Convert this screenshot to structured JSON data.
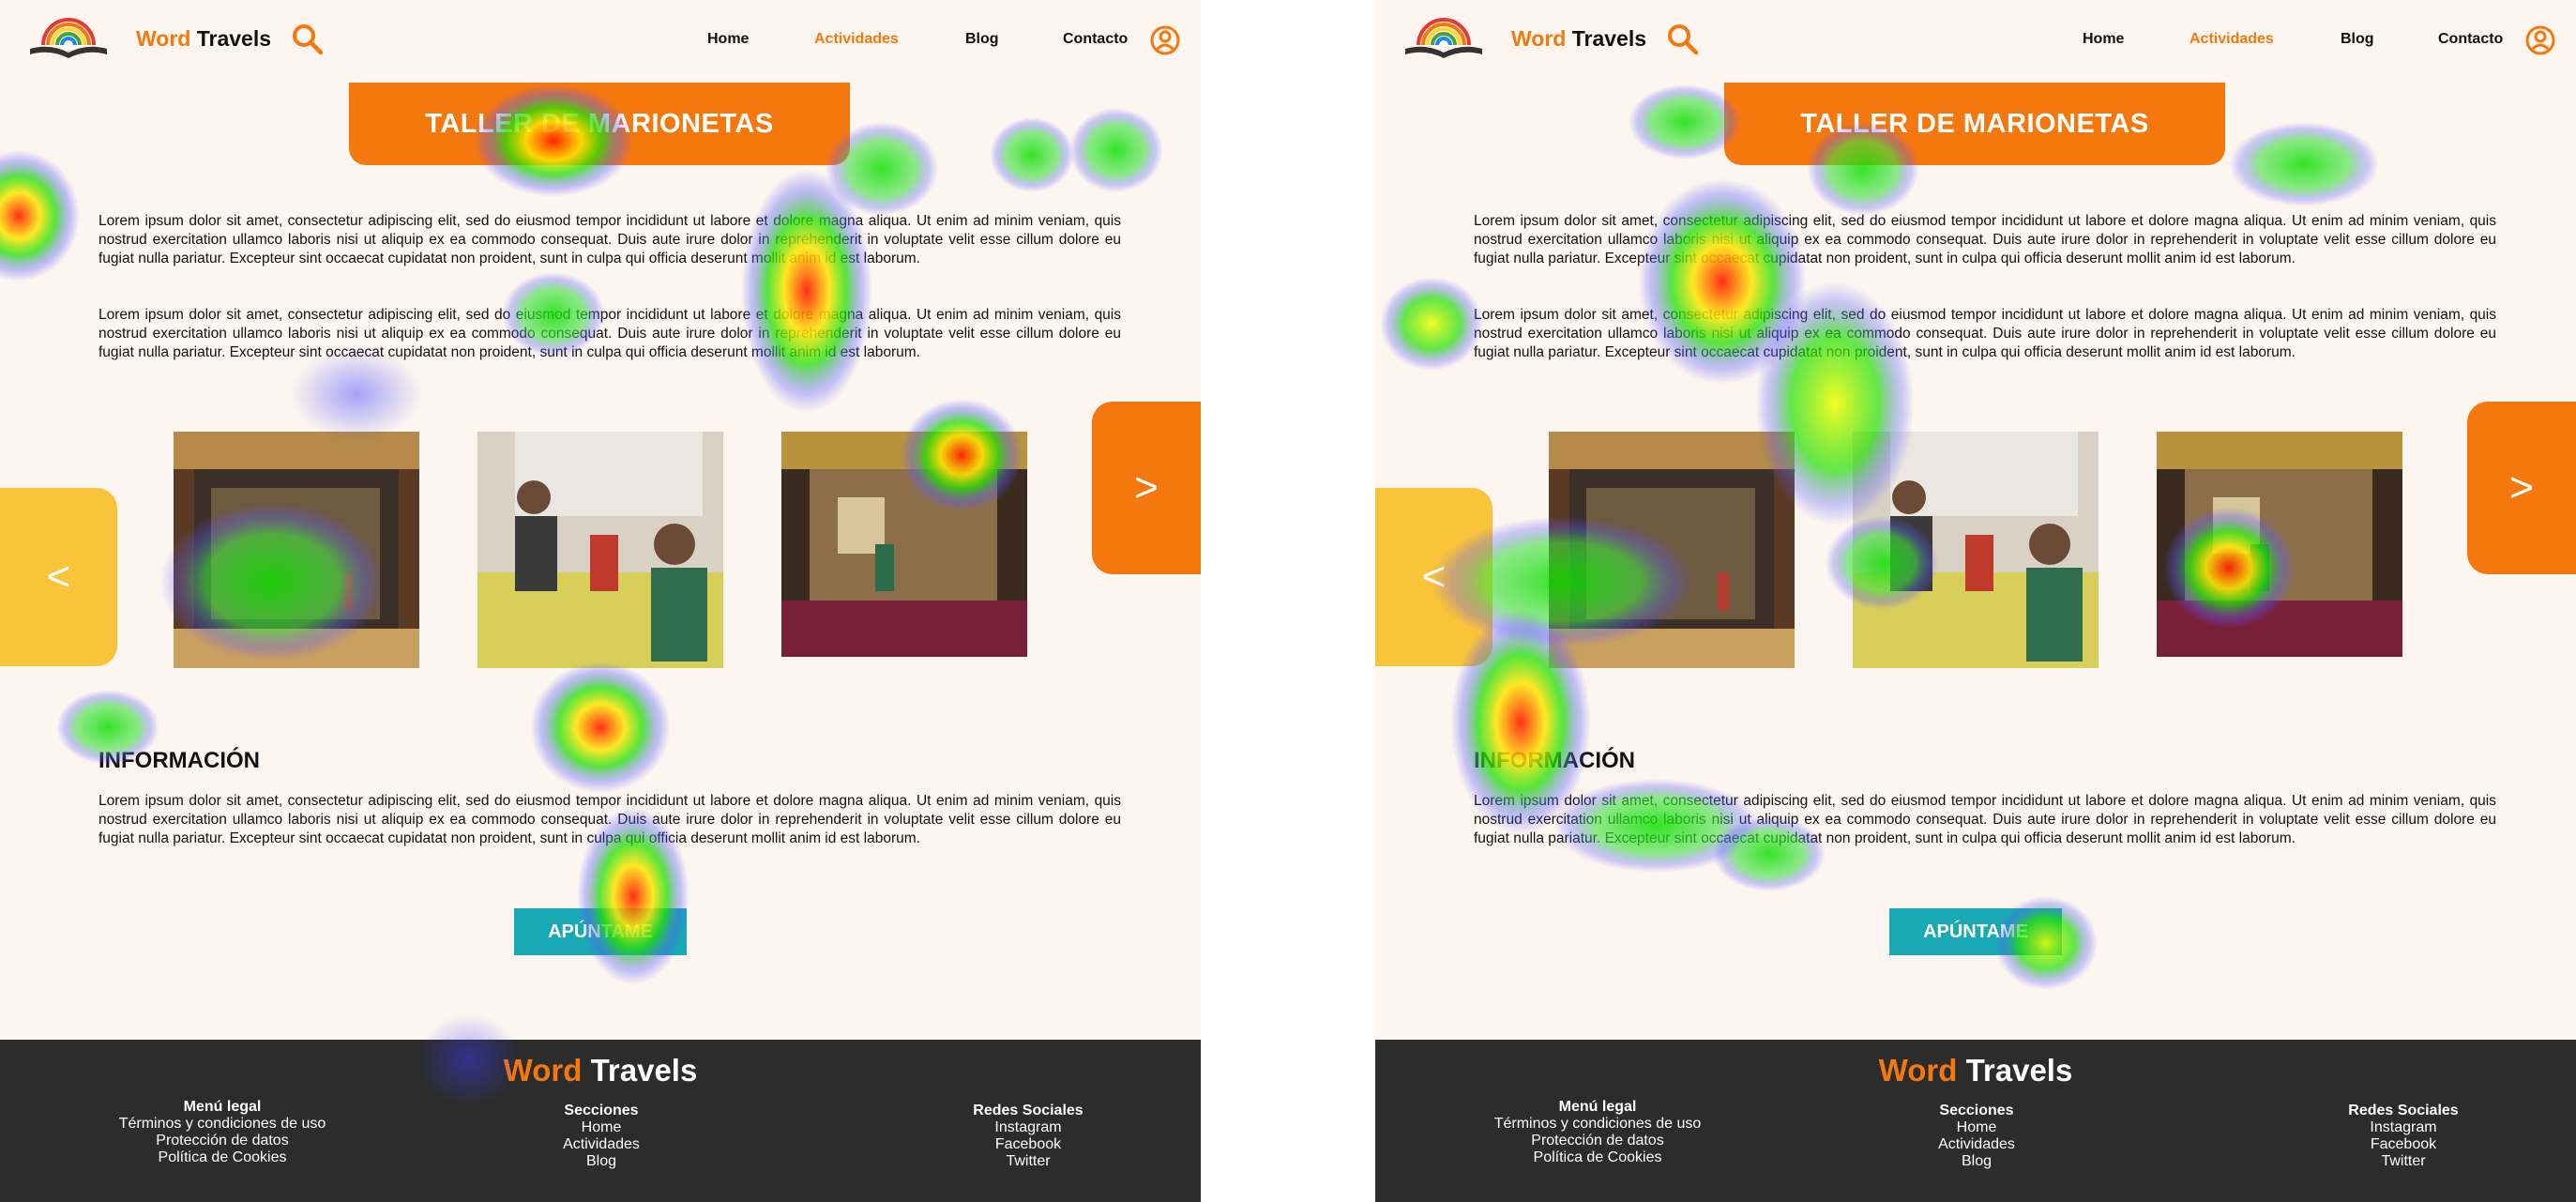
{
  "panels": [
    {
      "header": {
        "brand_word": "Word",
        "brand_rest": "Travels",
        "nav": [
          "Home",
          "Actividades",
          "Blog",
          "Contacto"
        ],
        "active_nav": "Actividades"
      },
      "banner": {
        "title": "TALLER DE MARIONETAS"
      },
      "paragraphs": [
        "Lorem ipsum dolor sit amet, consectetur adipiscing elit, sed do eiusmod tempor incididunt ut labore et dolore magna aliqua. Ut enim ad minim veniam, quis nostrud exercitation ullamco laboris nisi ut aliquip ex ea commodo consequat. Duis aute irure dolor in reprehenderit in voluptate velit esse cillum dolore eu fugiat nulla pariatur. Excepteur sint occaecat cupidatat non proident, sunt in culpa qui officia deserunt mollit anim id est laborum.",
        "Lorem ipsum dolor sit amet, consectetur adipiscing elit, sed do eiusmod tempor incididunt ut labore et dolore magna aliqua. Ut enim ad minim veniam, quis nostrud exercitation ullamco laboris nisi ut aliquip ex ea commodo consequat. Duis aute irure dolor in reprehenderit in voluptate velit esse cillum dolore eu fugiat nulla pariatur. Excepteur sint occaecat cupidatat non proident, sunt in culpa qui officia deserunt mollit anim id est laborum."
      ],
      "carousel": {
        "prev": "<",
        "next": ">"
      },
      "info": {
        "title": "INFORMACIÓN",
        "text": "Lorem ipsum dolor sit amet, consectetur adipiscing elit, sed do eiusmod tempor incididunt ut labore et dolore magna aliqua. Ut enim ad minim veniam, quis nostrud exercitation ullamco laboris nisi ut aliquip ex ea commodo consequat. Duis aute irure dolor in reprehenderit in voluptate velit esse cillum dolore eu fugiat nulla pariatur. Excepteur sint occaecat cupidatat non proident, sunt in culpa qui officia deserunt mollit anim id est laborum."
      },
      "cta": "APÚNTAME",
      "footer": {
        "brand_word": "Word",
        "brand_rest": "Travels",
        "legal": {
          "title": "Menú legal",
          "items": [
            "Términos y condiciones de uso",
            "Protección de datos",
            "Política de Cookies"
          ]
        },
        "sections": {
          "title": "Secciones",
          "items": [
            "Home",
            "Actividades",
            "Blog"
          ]
        },
        "social": {
          "title": "Redes Sociales",
          "items": [
            "Instagram",
            "Facebook",
            "Twitter"
          ]
        }
      }
    },
    {
      "header": {
        "brand_word": "Word",
        "brand_rest": "Travels",
        "nav": [
          "Home",
          "Actividades",
          "Blog",
          "Contacto"
        ],
        "active_nav": "Actividades"
      },
      "banner": {
        "title": "TALLER DE MARIONETAS"
      },
      "paragraphs": [
        "Lorem ipsum dolor sit amet, consectetur adipiscing elit, sed do eiusmod tempor incididunt ut labore et dolore magna aliqua. Ut enim ad minim veniam, quis nostrud exercitation ullamco laboris nisi ut aliquip ex ea commodo consequat. Duis aute irure dolor in reprehenderit in voluptate velit esse cillum dolore eu fugiat nulla pariatur. Excepteur sint occaecat cupidatat non proident, sunt in culpa qui officia deserunt mollit anim id est laborum.",
        "Lorem ipsum dolor sit amet, consectetur adipiscing elit, sed do eiusmod tempor incididunt ut labore et dolore magna aliqua. Ut enim ad minim veniam, quis nostrud exercitation ullamco laboris nisi ut aliquip ex ea commodo consequat. Duis aute irure dolor in reprehenderit in voluptate velit esse cillum dolore eu fugiat nulla pariatur. Excepteur sint occaecat cupidatat non proident, sunt in culpa qui officia deserunt mollit anim id est laborum."
      ],
      "carousel": {
        "prev": "<",
        "next": ">"
      },
      "info": {
        "title": "INFORMACIÓN",
        "text": "Lorem ipsum dolor sit amet, consectetur adipiscing elit, sed do eiusmod tempor incididunt ut labore et dolore magna aliqua. Ut enim ad minim veniam, quis nostrud exercitation ullamco laboris nisi ut aliquip ex ea commodo consequat. Duis aute irure dolor in reprehenderit in voluptate velit esse cillum dolore eu fugiat nulla pariatur. Excepteur sint occaecat cupidatat non proident, sunt in culpa qui officia deserunt mollit anim id est laborum."
      },
      "cta": "APÚNTAME",
      "footer": {
        "brand_word": "Word",
        "brand_rest": "Travels",
        "legal": {
          "title": "Menú legal",
          "items": [
            "Términos y condiciones de uso",
            "Protección de datos",
            "Política de Cookies"
          ]
        },
        "sections": {
          "title": "Secciones",
          "items": [
            "Home",
            "Actividades",
            "Blog"
          ]
        },
        "social": {
          "title": "Redes Sociales",
          "items": [
            "Instagram",
            "Facebook",
            "Twitter"
          ]
        }
      }
    }
  ],
  "colors": {
    "brand_orange": "#f5780f",
    "arrow_yellow": "#f9c43a",
    "cta_teal": "#19a9b5",
    "footer_dark": "#2c2c2c",
    "page_bg": "#fdf6f0"
  }
}
